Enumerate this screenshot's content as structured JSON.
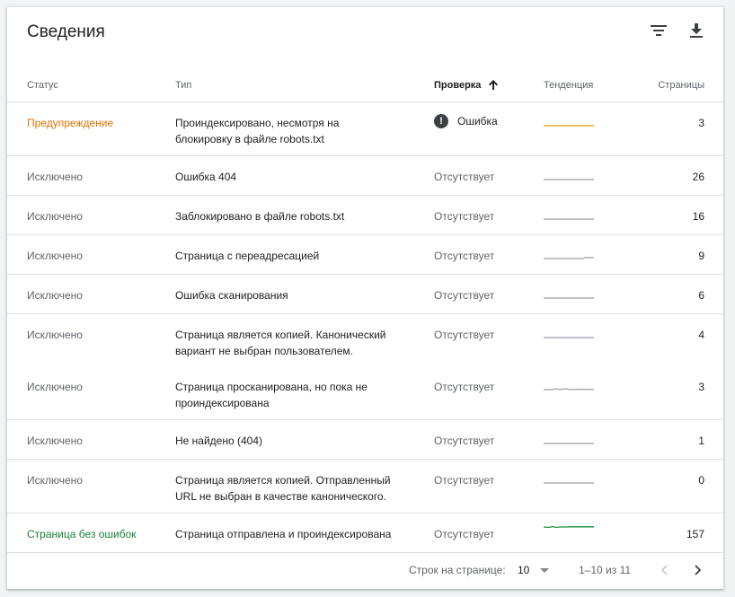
{
  "header": {
    "title": "Сведения",
    "icons": [
      "filter-icon",
      "download-icon"
    ]
  },
  "columns": {
    "status": "Статус",
    "type": "Тип",
    "check": "Проверка",
    "trend": "Тенденция",
    "pages": "Страницы"
  },
  "sort": {
    "column": "check",
    "direction": "ascending",
    "icon": "arrow-up-icon"
  },
  "colors": {
    "warning": "#e37400",
    "ok": "#188038",
    "trend_warning": "#f29900",
    "trend_ok": "#1e8e3e",
    "trend_neutral": "#9aa0a6"
  },
  "rows": [
    {
      "status": "Предупреждение",
      "status_kind": "warning",
      "type_line1": "Проиндексировано, несмотря на",
      "type_line2": "блокировку в файле robots.txt",
      "check": "Ошибка",
      "check_kind": "error",
      "trend_kind": "warning",
      "trend_shape": "flat",
      "pages": "3"
    },
    {
      "status": "Исключено",
      "status_kind": "excluded",
      "type_line1": "Ошибка 404",
      "type_line2": "",
      "check": "Отсутствует",
      "check_kind": "none",
      "trend_kind": "neutral",
      "trend_shape": "flat",
      "pages": "26"
    },
    {
      "status": "Исключено",
      "status_kind": "excluded",
      "type_line1": "Заблокировано в файле robots.txt",
      "type_line2": "",
      "check": "Отсутствует",
      "check_kind": "none",
      "trend_kind": "neutral",
      "trend_shape": "flat",
      "pages": "16"
    },
    {
      "status": "Исключено",
      "status_kind": "excluded",
      "type_line1": "Страница с переадресацией",
      "type_line2": "",
      "check": "Отсутствует",
      "check_kind": "none",
      "trend_kind": "neutral",
      "trend_shape": "step-up",
      "pages": "9"
    },
    {
      "status": "Исключено",
      "status_kind": "excluded",
      "type_line1": "Ошибка сканирования",
      "type_line2": "",
      "check": "Отсутствует",
      "check_kind": "none",
      "trend_kind": "neutral",
      "trend_shape": "flat",
      "pages": "6"
    },
    {
      "status": "Исключено",
      "status_kind": "excluded",
      "type_line1": "Страница является копией. Канонический",
      "type_line2": "вариант не выбран пользователем.",
      "check": "Отсутствует",
      "check_kind": "none",
      "trend_kind": "neutral",
      "trend_shape": "flat",
      "pages": "4"
    },
    {
      "status": "Исключено",
      "status_kind": "excluded",
      "type_line1": "Страница просканирована, но пока не",
      "type_line2": "проиндексирована",
      "check": "Отсутствует",
      "check_kind": "none",
      "trend_kind": "neutral",
      "trend_shape": "bumpy",
      "pages": "3"
    },
    {
      "status": "Исключено",
      "status_kind": "excluded",
      "type_line1": "Не найдено (404)",
      "type_line2": "",
      "check": "Отсутствует",
      "check_kind": "none",
      "trend_kind": "neutral",
      "trend_shape": "flat",
      "pages": "1"
    },
    {
      "status": "Исключено",
      "status_kind": "excluded",
      "type_line1": "Страница является копией. Отправленный",
      "type_line2": "URL не выбран в качестве канонического.",
      "check": "Отсутствует",
      "check_kind": "none",
      "trend_kind": "neutral",
      "trend_shape": "flat",
      "pages": "0"
    },
    {
      "status": "Страница без ошибок",
      "status_kind": "ok",
      "type_line1": "Страница отправлена и проиндексирована",
      "type_line2": "",
      "check": "Отсутствует",
      "check_kind": "none",
      "trend_kind": "ok",
      "trend_shape": "wavy",
      "pages": "157"
    }
  ],
  "pagination": {
    "rows_per_page_label": "Строк на странице:",
    "rows_per_page_value": "10",
    "range_text": "1–10 из 11",
    "prev_icon": "chevron-left-icon",
    "next_icon": "chevron-right-icon",
    "prev_enabled": false,
    "next_enabled": true
  }
}
